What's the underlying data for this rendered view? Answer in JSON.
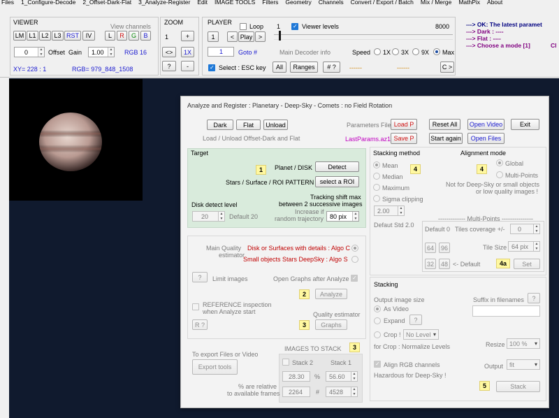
{
  "menu": [
    "Files",
    "1_Configure-Decode",
    "2_Offset-Dark-Flat",
    "3_Analyze-Register",
    "Edit",
    "IMAGE TOOLS",
    "Filters",
    "Geometry",
    "Channels",
    "Convert / Export / Batch",
    "Mix / Merge",
    "MathPix",
    "About"
  ],
  "viewer": {
    "title": "VIEWER",
    "view_channels": "View channels",
    "btn_lm": "LM",
    "btn_l1": "L1",
    "btn_l2": "L2",
    "btn_l3": "L3",
    "btn_rst": "RST",
    "btn_iv": "IV",
    "ch_l": "L",
    "ch_r": "R",
    "ch_g": "G",
    "ch_b": "B",
    "offset_value": "0",
    "offset_label": "Offset",
    "gain_label": "Gain",
    "gain_value": "1.00",
    "rgb_mode": "RGB 16",
    "xy": "XY=  228 : 1",
    "rgb": "RGB=  979_848_1508"
  },
  "zoom": {
    "title": "ZOOM",
    "value": "1",
    "plus": "+",
    "fit": "<>",
    "one_x": "1X",
    "help": "?",
    "minus": "-"
  },
  "player": {
    "title": "PLAYER",
    "loop_label": "Loop",
    "frame_current": "1",
    "viewer_levels_label": "Viewer levels",
    "frame_max": "8000",
    "btn_first": "1",
    "btn_prev": "<",
    "btn_play": "Play",
    "btn_next": ">",
    "goto_value": "1",
    "goto_label": "Goto #",
    "decoder_info": "Main Decoder info",
    "speed_label": "Speed",
    "speed_options": [
      "1X",
      "3X",
      "9X",
      "Max"
    ],
    "select_label": "Select :  ESC key",
    "btn_all": "All",
    "btn_ranges": "Ranges",
    "btn_hash": "# ?",
    "dashes1": "------",
    "dashes2": "------",
    "btn_c": "C >"
  },
  "status": {
    "line1": "--->  OK:  The latest paramet",
    "line2": "--->  Dark :  ----",
    "line3": "--->  Flat  :  ----",
    "line4": "--->  Choose a mode  [1]",
    "line4_extra": "Cl"
  },
  "dialog": {
    "title": "Analyze and Register :    Planetary - Deep-Sky - Comets :  no Field Rotation",
    "btn_dark": "Dark",
    "btn_flat": "Flat",
    "btn_unload": "Unload",
    "load_unload_label": "Load / Unload Offset-Dark and Flat",
    "params_file_label": "Parameters File",
    "btn_load_p": "Load P",
    "btn_reset_all": "Reset All",
    "btn_open_video": "Open Video",
    "btn_exit": "Exit",
    "last_params": "LastParams.az1",
    "btn_save_p": "Save P",
    "btn_start_again": "Start again",
    "btn_open_files": "Open Files",
    "target": {
      "title": "Target",
      "badge": "1",
      "planet_label": "Planet / DISK",
      "btn_detect": "Detect",
      "stars_label": "Stars / Surface / ROI PATTERN",
      "btn_select_roi": "select a ROI",
      "shift_line1": "Tracking shift max",
      "shift_line2": "between 2 successive images",
      "disk_detect_label": "Disk detect level",
      "increase_line1": "Increase if",
      "increase_line2": "random trajectory",
      "disk_value": "20",
      "disk_default": "Default 20",
      "shift_value": "80 pix"
    },
    "quality": {
      "label_line1": "Main Quality",
      "label_line2": "estimator",
      "algo_c": "Disk or Surfaces with details :  Algo C",
      "algo_s": "Small objects  Stars  DeepSky :  Algo S",
      "btn_help": "?",
      "limit_images": "Limit images",
      "open_graphs": "Open Graphs after Analyze",
      "badge_analyze": "2",
      "btn_analyze": "Analyze",
      "ref_line1": "REFERENCE  inspection",
      "ref_line2": "when Analyze start",
      "quality_estimator": "Quality estimator",
      "btn_r": "R ?",
      "badge_graphs": "3",
      "btn_graphs": "Graphs"
    },
    "images": {
      "export_label": "To export Files or Video",
      "btn_export": "Export tools",
      "title": "IMAGES TO STACK",
      "badge": "3",
      "stack2_label": "Stack 2",
      "stack1_label": "Stack 1",
      "pct2": "28.30",
      "pct_sign": "%",
      "pct1": "56.60",
      "relative_line1": "% are relative",
      "relative_line2": "to available frames",
      "count2": "2264",
      "hash_sign": "#",
      "count1": "4528"
    },
    "stacking_method": {
      "title": "Stacking method",
      "badge": "4",
      "options": [
        "Mean",
        "Median",
        "Maximum",
        "Sigma clipping"
      ],
      "sigma_value": "2.00",
      "sigma_default": "Defaut Std 2.0"
    },
    "alignment": {
      "title": "Alignment mode",
      "badge": "4",
      "global": "Global",
      "multi_points": "Multi-Points",
      "note_line1": "Not for Deep-Sky or small objects",
      "note_line2": "or low quality images !"
    },
    "multipoints": {
      "title": "------------- Multi-Points  ---------------",
      "default0": "Default 0",
      "coverage_label": "Tiles coverage +/-",
      "coverage_value": "0",
      "btn_64": "64",
      "btn_96": "96",
      "tile_size_label": "Tile Size",
      "tile_size_value": "64 pix",
      "btn_32": "32",
      "btn_48": "48",
      "default_label": "<- Default",
      "badge": "4a",
      "btn_set": "Set"
    },
    "stacking": {
      "title": "Stacking",
      "output_size_label": "Output  image size",
      "suffix_label": "Suffix in filenames",
      "btn_suffix_help": "?",
      "as_video": "As Video",
      "expand": "Expand",
      "btn_expand_help": "?",
      "crop_label": "Crop !",
      "crop_select": "No Level",
      "resize_label": "Resize",
      "resize_value": "100 %",
      "crop_note": "for Crop :  Normalize Levels",
      "align_rgb": "Align RGB channels",
      "output_label": "Output",
      "output_value": "fit",
      "hazardous": "Hazardous for Deep-Sky !",
      "badge": "5",
      "btn_stack": "Stack"
    }
  }
}
